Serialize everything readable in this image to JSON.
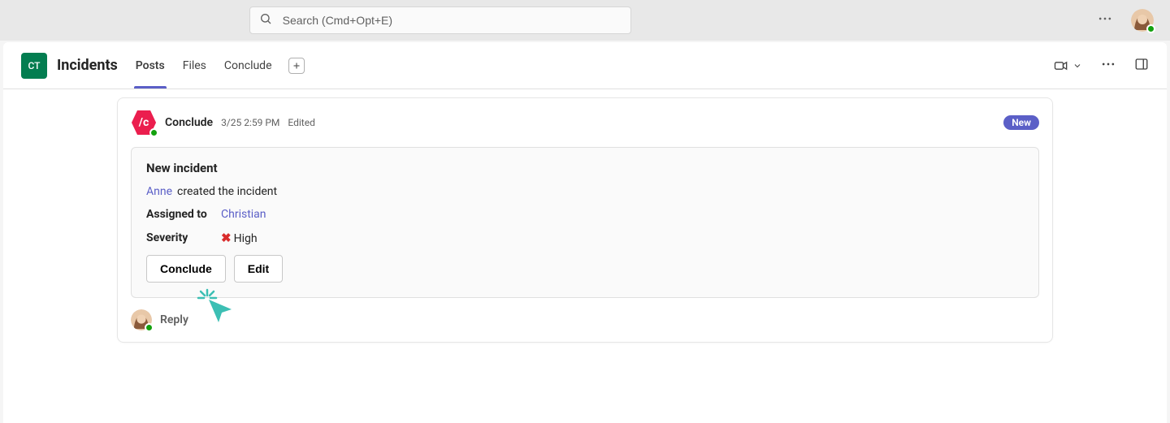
{
  "search": {
    "placeholder": "Search (Cmd+Opt+E)"
  },
  "channel": {
    "icon_text": "CT",
    "title": "Incidents",
    "tabs": [
      {
        "label": "Posts",
        "active": true
      },
      {
        "label": "Files",
        "active": false
      },
      {
        "label": "Conclude",
        "active": false
      }
    ]
  },
  "post": {
    "sender": "Conclude",
    "app_icon_text": "/c",
    "timestamp": "3/25 2:59 PM",
    "edited_label": "Edited",
    "badge": "New",
    "card": {
      "title": "New incident",
      "creator_mention": "Anne",
      "creator_suffix": "created the incident",
      "assigned_label": "Assigned to",
      "assigned_mention": "Christian",
      "severity_label": "Severity",
      "severity_value": "High",
      "actions": {
        "conclude": "Conclude",
        "edit": "Edit"
      }
    },
    "reply_label": "Reply"
  }
}
